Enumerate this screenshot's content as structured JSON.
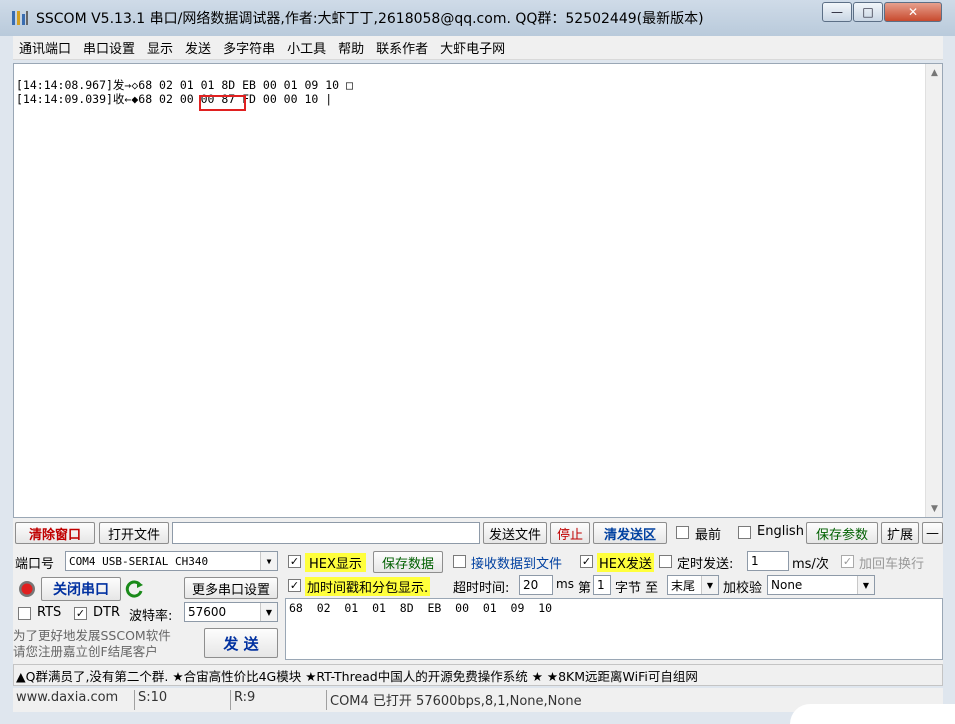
{
  "window": {
    "title": "SSCOM V5.13.1 串口/网络数据调试器,作者:大虾丁丁,2618058@qq.com. QQ群：52502449(最新版本)",
    "min_label": "—",
    "max_label": "□",
    "close_label": "✕"
  },
  "menu": [
    "通讯端口",
    "串口设置",
    "显示",
    "发送",
    "多字符串",
    "小工具",
    "帮助",
    "联系作者",
    "大虾电子网"
  ],
  "receive": {
    "lines": [
      "[14:14:08.967]发→◇68 02 01 01 8D EB 00 01 09 10 □",
      "[14:14:09.039]收←◆68 02 00 00 87 FD 00 00 10 |"
    ]
  },
  "toolbar": {
    "clear_window": "清除窗口",
    "open_file": "打开文件",
    "file_path": "",
    "send_file": "发送文件",
    "stop": "停止",
    "clear_send": "清发送区",
    "topmost": "最前",
    "english": "English",
    "save_params": "保存参数",
    "expand": "扩展",
    "collapse": "—"
  },
  "port": {
    "port_label": "端口号",
    "port_value": "COM4 USB-SERIAL CH340",
    "close_port": "关闭串口",
    "more_settings": "更多串口设置",
    "rts": "RTS",
    "dtr": "DTR",
    "baud_label": "波特率:",
    "baud_value": "57600",
    "promo": "为了更好地发展SSCOM软件\n请您注册嘉立创F结尾客户",
    "send": "发 送"
  },
  "options": {
    "hex_display": "HEX显示",
    "save_data": "保存数据",
    "recv_to_file": "接收数据到文件",
    "hex_send": "HEX发送",
    "timed_send": "定时发送:",
    "interval": "1",
    "interval_unit": "ms/次",
    "add_crlf": "加回车换行",
    "timestamp": "加时间戳和分包显示.",
    "timeout_label": "超时时间:",
    "timeout_value": "20",
    "timeout_unit": "ms",
    "nth_label": "第",
    "nth_value": "1",
    "byte_label": "字节 至",
    "end_value": "末尾",
    "checksum_label": "加校验",
    "checksum_value": "None"
  },
  "send_data": "68  02  01  01  8D  EB  00  01  09  10",
  "marquee": "▲Q群满员了,没有第二个群. ★合宙高性价比4G模块 ★RT-Thread中国人的开源免费操作系统 ★ ★8KM远距离WiFi可自组网",
  "status": {
    "website": "www.daxia.com",
    "sent": "S:10",
    "received": "R:9",
    "port_status": "COM4 已打开  57600bps,8,1,None,None"
  }
}
